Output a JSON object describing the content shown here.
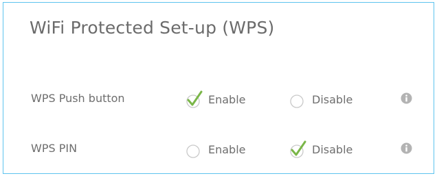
{
  "title": "WiFi Protected Set-up (WPS)",
  "rows": [
    {
      "label": "WPS Push button",
      "options": [
        {
          "label": "Enable",
          "selected": true
        },
        {
          "label": "Disable",
          "selected": false
        }
      ]
    },
    {
      "label": "WPS PIN",
      "options": [
        {
          "label": "Enable",
          "selected": false
        },
        {
          "label": "Disable",
          "selected": true
        }
      ]
    }
  ],
  "colors": {
    "border": "#5cc3ef",
    "check": "#7ab648",
    "radio_ring": "#c9c9c9",
    "info": "#b3b3b3",
    "text": "#6e6e6e"
  },
  "icons": {
    "selected": "check-icon",
    "unselected": "radio-icon",
    "info": "info-icon"
  }
}
